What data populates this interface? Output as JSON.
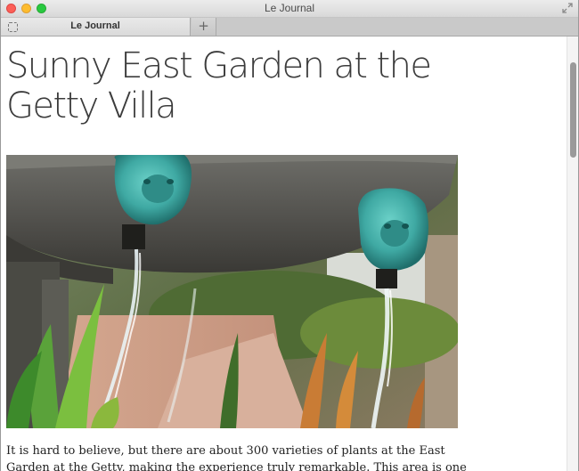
{
  "window": {
    "title": "Le Journal",
    "tab_label": "Le Journal",
    "new_tab_symbol": "+",
    "icons": [
      "close-icon",
      "minimize-icon",
      "zoom-icon",
      "fullscreen-icon",
      "tab-close-icon"
    ]
  },
  "article": {
    "headline": "Sunny East Garden at the Getty Villa",
    "paragraph": "It is hard to believe, but there are about 300 varieties of plants at the East Garden at the Getty, making the experience truly remarkable. This area is one of the most"
  },
  "colors": {
    "close": "#fc5f57",
    "minimize": "#fdbc2e",
    "zoom": "#28c940",
    "headline": "#3c3c3c",
    "fountain_bronze": "#3fa9a3"
  },
  "scrollbar": {
    "position_fraction": 0.0
  }
}
